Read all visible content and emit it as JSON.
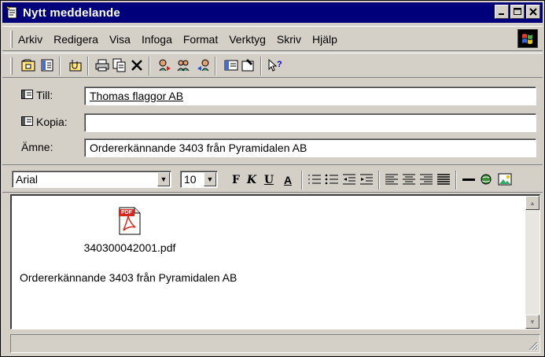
{
  "window": {
    "title": "Nytt meddelande"
  },
  "menubar": {
    "items": [
      "Arkiv",
      "Redigera",
      "Visa",
      "Infoga",
      "Format",
      "Verktyg",
      "Skriv",
      "Hjälp"
    ]
  },
  "header": {
    "to_label": "Till:",
    "to_value": "Thomas flaggor AB",
    "cc_label": "Kopia:",
    "cc_value": "",
    "subject_label": "Ämne:",
    "subject_value": "Ordererkännande 3403 från Pyramidalen AB"
  },
  "formatbar": {
    "font": "Arial",
    "size": "10",
    "bold": "F",
    "italic": "K",
    "underline": "U",
    "color": "A"
  },
  "message": {
    "attachment_name": "340300042001.pdf",
    "attachment_badge": "PDF",
    "body_text": "Ordererkännande 3403 från Pyramidalen AB"
  },
  "colors": {
    "titlebar": "#00007b",
    "face": "#d4d0c8",
    "pdf_red": "#d9261c"
  }
}
